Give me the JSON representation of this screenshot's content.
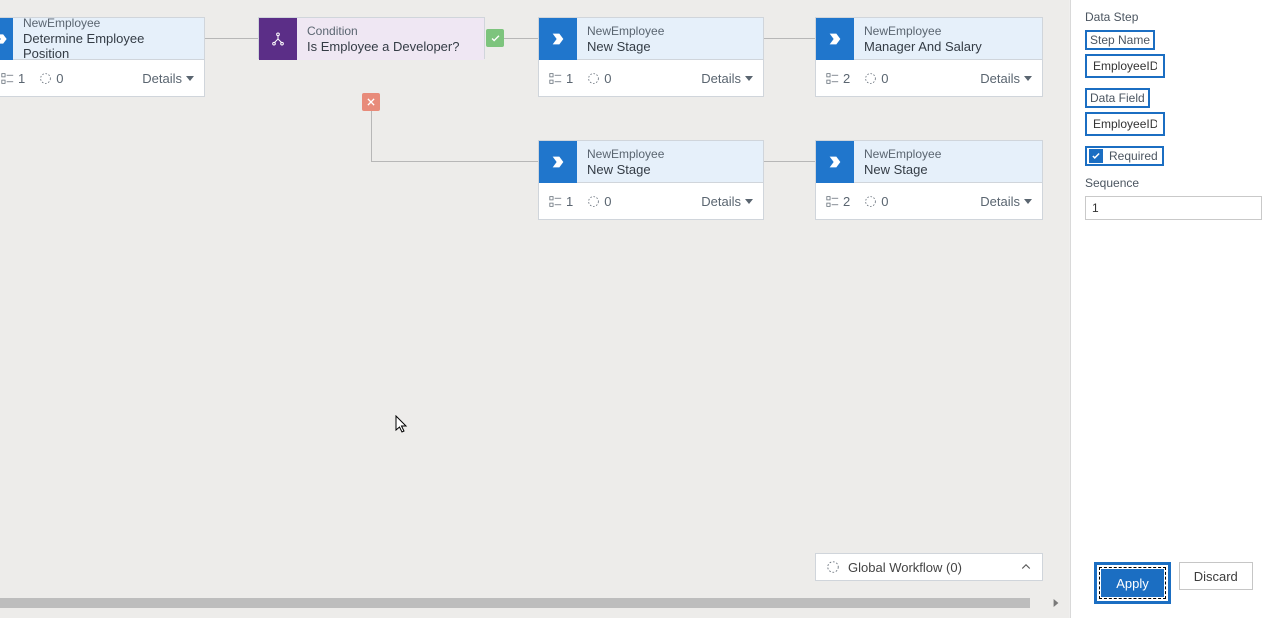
{
  "canvas": {
    "card1": {
      "pre": "NewEmployee",
      "title": "Determine Employee Position",
      "stat1": "1",
      "stat2": "0",
      "details": "Details"
    },
    "cond": {
      "pre": "Condition",
      "title": "Is Employee a Developer?"
    },
    "card3": {
      "pre": "NewEmployee",
      "title": "New Stage",
      "stat1": "1",
      "stat2": "0",
      "details": "Details"
    },
    "card4": {
      "pre": "NewEmployee",
      "title": "Manager And Salary",
      "stat1": "2",
      "stat2": "0",
      "details": "Details"
    },
    "card5": {
      "pre": "NewEmployee",
      "title": "New Stage",
      "stat1": "1",
      "stat2": "0",
      "details": "Details"
    },
    "card6": {
      "pre": "NewEmployee",
      "title": "New Stage",
      "stat1": "2",
      "stat2": "0",
      "details": "Details"
    }
  },
  "globalBar": {
    "label": "Global Workflow (0)"
  },
  "panel": {
    "header": "Data Step",
    "stepNameLabel": "Step Name",
    "stepNameValue": "EmployeeID",
    "dataFieldLabel": "Data Field",
    "dataFieldValue": "EmployeeID",
    "requiredLabel": "Required",
    "sequenceLabel": "Sequence",
    "sequenceValue": "1",
    "applyLabel": "Apply",
    "discardLabel": "Discard"
  }
}
